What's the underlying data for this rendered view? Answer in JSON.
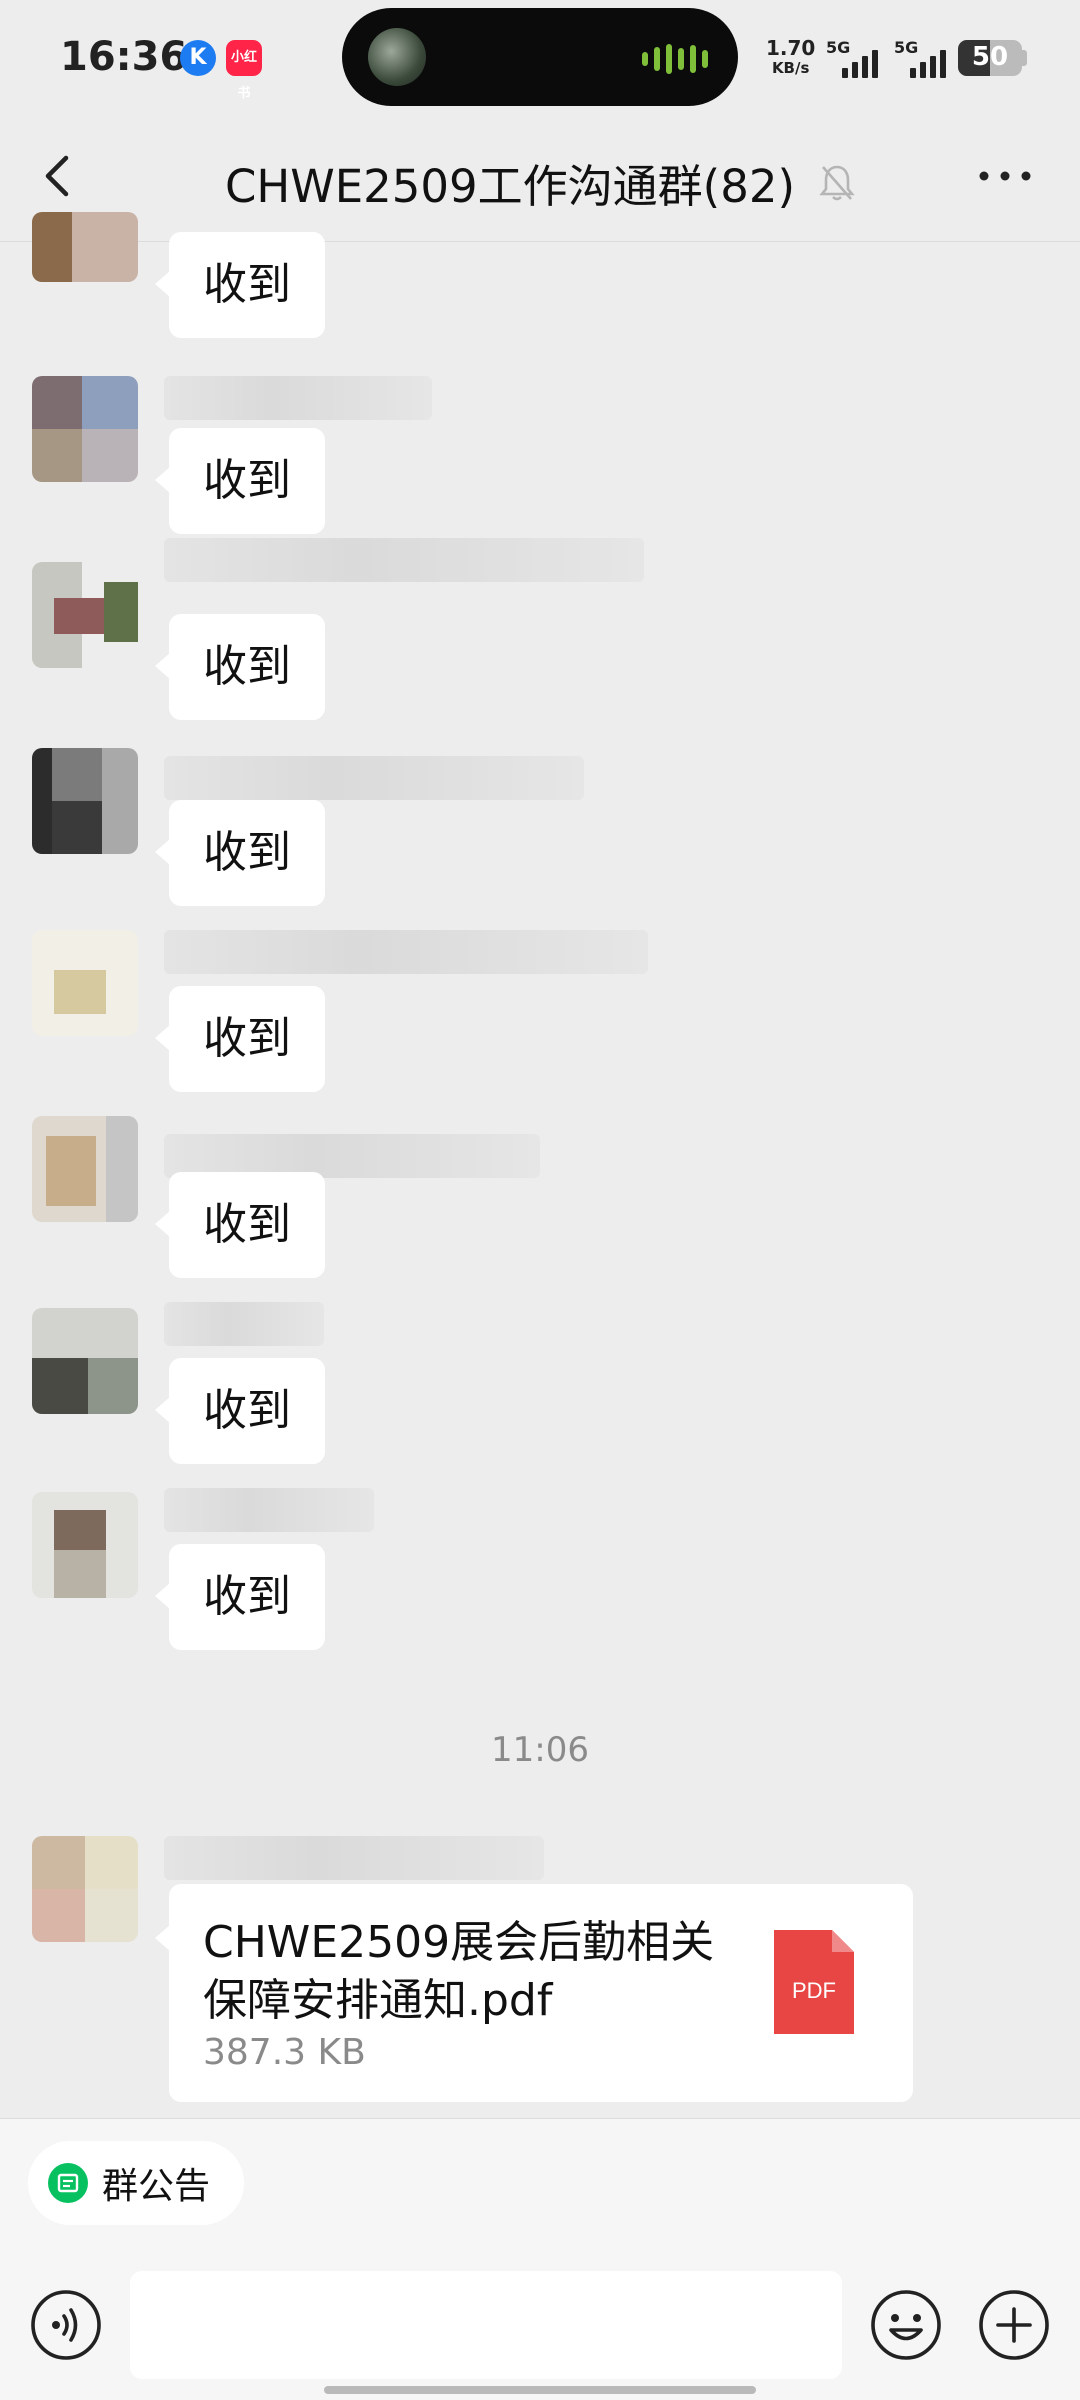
{
  "status_bar": {
    "time": "16:36",
    "badge_k": "K",
    "badge_r": "小红书",
    "net_speed_value": "1.70",
    "net_speed_unit": "KB/s",
    "sim1": "5G",
    "sim2": "5G",
    "battery": "50"
  },
  "header": {
    "title": "CHWE2509工作沟通群(82)"
  },
  "messages": [
    {
      "text": "收到"
    },
    {
      "text": "收到"
    },
    {
      "text": "收到"
    },
    {
      "text": "收到"
    },
    {
      "text": "收到"
    },
    {
      "text": "收到"
    },
    {
      "text": "收到"
    },
    {
      "text": "收到"
    }
  ],
  "timestamp": "11:06",
  "file_message": {
    "file_name": "CHWE2509展会后勤相关保障安排通知.pdf",
    "file_size": "387.3 KB",
    "file_type": "PDF"
  },
  "bottom": {
    "notice_label": "群公告"
  },
  "colors": {
    "background": "#ededed",
    "bubble": "#ffffff",
    "accent_green": "#07c160",
    "pdf_red": "#e84545"
  }
}
